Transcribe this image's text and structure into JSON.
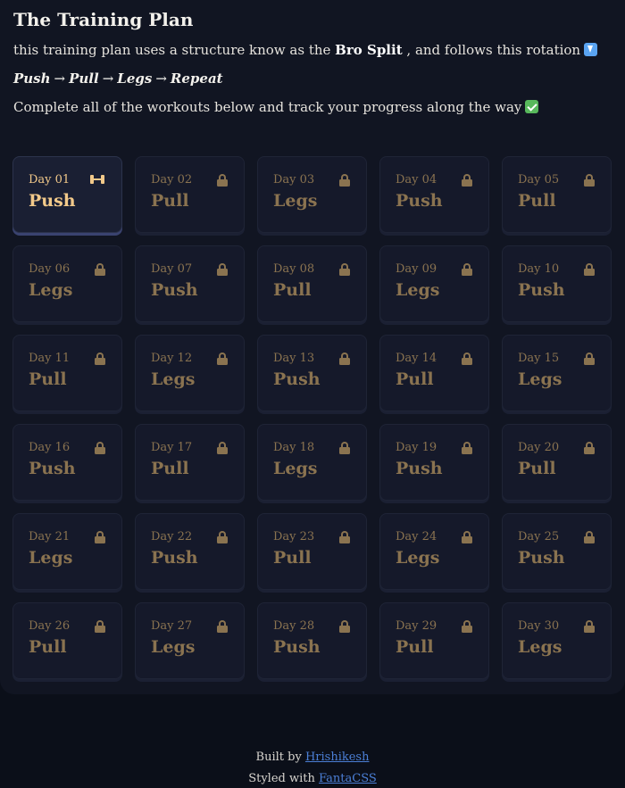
{
  "header": {
    "title": "The Training Plan",
    "intro_before": "this training plan uses a structure know as the",
    "intro_bold": "Bro Split",
    "intro_after": ", and follows this rotation",
    "down_icon": "arrow-down-emoji",
    "rotation": [
      "Push",
      "Pull",
      "Legs",
      "Repeat"
    ],
    "rotation_separator": "→",
    "complete_text": "Complete all of the workouts below and track your progress along the way",
    "check_icon": "check-mark-emoji"
  },
  "days": [
    {
      "day": "Day 01",
      "workout": "Push",
      "status": "active",
      "icon": "dumbbell-icon"
    },
    {
      "day": "Day 02",
      "workout": "Pull",
      "status": "locked",
      "icon": "lock-icon"
    },
    {
      "day": "Day 03",
      "workout": "Legs",
      "status": "locked",
      "icon": "lock-icon"
    },
    {
      "day": "Day 04",
      "workout": "Push",
      "status": "locked",
      "icon": "lock-icon"
    },
    {
      "day": "Day 05",
      "workout": "Pull",
      "status": "locked",
      "icon": "lock-icon"
    },
    {
      "day": "Day 06",
      "workout": "Legs",
      "status": "locked",
      "icon": "lock-icon"
    },
    {
      "day": "Day 07",
      "workout": "Push",
      "status": "locked",
      "icon": "lock-icon"
    },
    {
      "day": "Day 08",
      "workout": "Pull",
      "status": "locked",
      "icon": "lock-icon"
    },
    {
      "day": "Day 09",
      "workout": "Legs",
      "status": "locked",
      "icon": "lock-icon"
    },
    {
      "day": "Day 10",
      "workout": "Push",
      "status": "locked",
      "icon": "lock-icon"
    },
    {
      "day": "Day 11",
      "workout": "Pull",
      "status": "locked",
      "icon": "lock-icon"
    },
    {
      "day": "Day 12",
      "workout": "Legs",
      "status": "locked",
      "icon": "lock-icon"
    },
    {
      "day": "Day 13",
      "workout": "Push",
      "status": "locked",
      "icon": "lock-icon"
    },
    {
      "day": "Day 14",
      "workout": "Pull",
      "status": "locked",
      "icon": "lock-icon"
    },
    {
      "day": "Day 15",
      "workout": "Legs",
      "status": "locked",
      "icon": "lock-icon"
    },
    {
      "day": "Day 16",
      "workout": "Push",
      "status": "locked",
      "icon": "lock-icon"
    },
    {
      "day": "Day 17",
      "workout": "Pull",
      "status": "locked",
      "icon": "lock-icon"
    },
    {
      "day": "Day 18",
      "workout": "Legs",
      "status": "locked",
      "icon": "lock-icon"
    },
    {
      "day": "Day 19",
      "workout": "Push",
      "status": "locked",
      "icon": "lock-icon"
    },
    {
      "day": "Day 20",
      "workout": "Pull",
      "status": "locked",
      "icon": "lock-icon"
    },
    {
      "day": "Day 21",
      "workout": "Legs",
      "status": "locked",
      "icon": "lock-icon"
    },
    {
      "day": "Day 22",
      "workout": "Push",
      "status": "locked",
      "icon": "lock-icon"
    },
    {
      "day": "Day 23",
      "workout": "Pull",
      "status": "locked",
      "icon": "lock-icon"
    },
    {
      "day": "Day 24",
      "workout": "Legs",
      "status": "locked",
      "icon": "lock-icon"
    },
    {
      "day": "Day 25",
      "workout": "Push",
      "status": "locked",
      "icon": "lock-icon"
    },
    {
      "day": "Day 26",
      "workout": "Pull",
      "status": "locked",
      "icon": "lock-icon"
    },
    {
      "day": "Day 27",
      "workout": "Legs",
      "status": "locked",
      "icon": "lock-icon"
    },
    {
      "day": "Day 28",
      "workout": "Push",
      "status": "locked",
      "icon": "lock-icon"
    },
    {
      "day": "Day 29",
      "workout": "Pull",
      "status": "locked",
      "icon": "lock-icon"
    },
    {
      "day": "Day 30",
      "workout": "Legs",
      "status": "locked",
      "icon": "lock-icon"
    }
  ],
  "footer": {
    "built_by_prefix": "Built by",
    "built_by_link": "Hrishikesh",
    "styled_with_prefix": "Styled with",
    "styled_with_link": "FantaCSS"
  },
  "colors": {
    "background": "#0b0f19",
    "panel": "#111522",
    "card": "#15192a",
    "active_text": "#f2c98a",
    "locked_text": "#8a7350",
    "link": "#4b7fd6"
  }
}
